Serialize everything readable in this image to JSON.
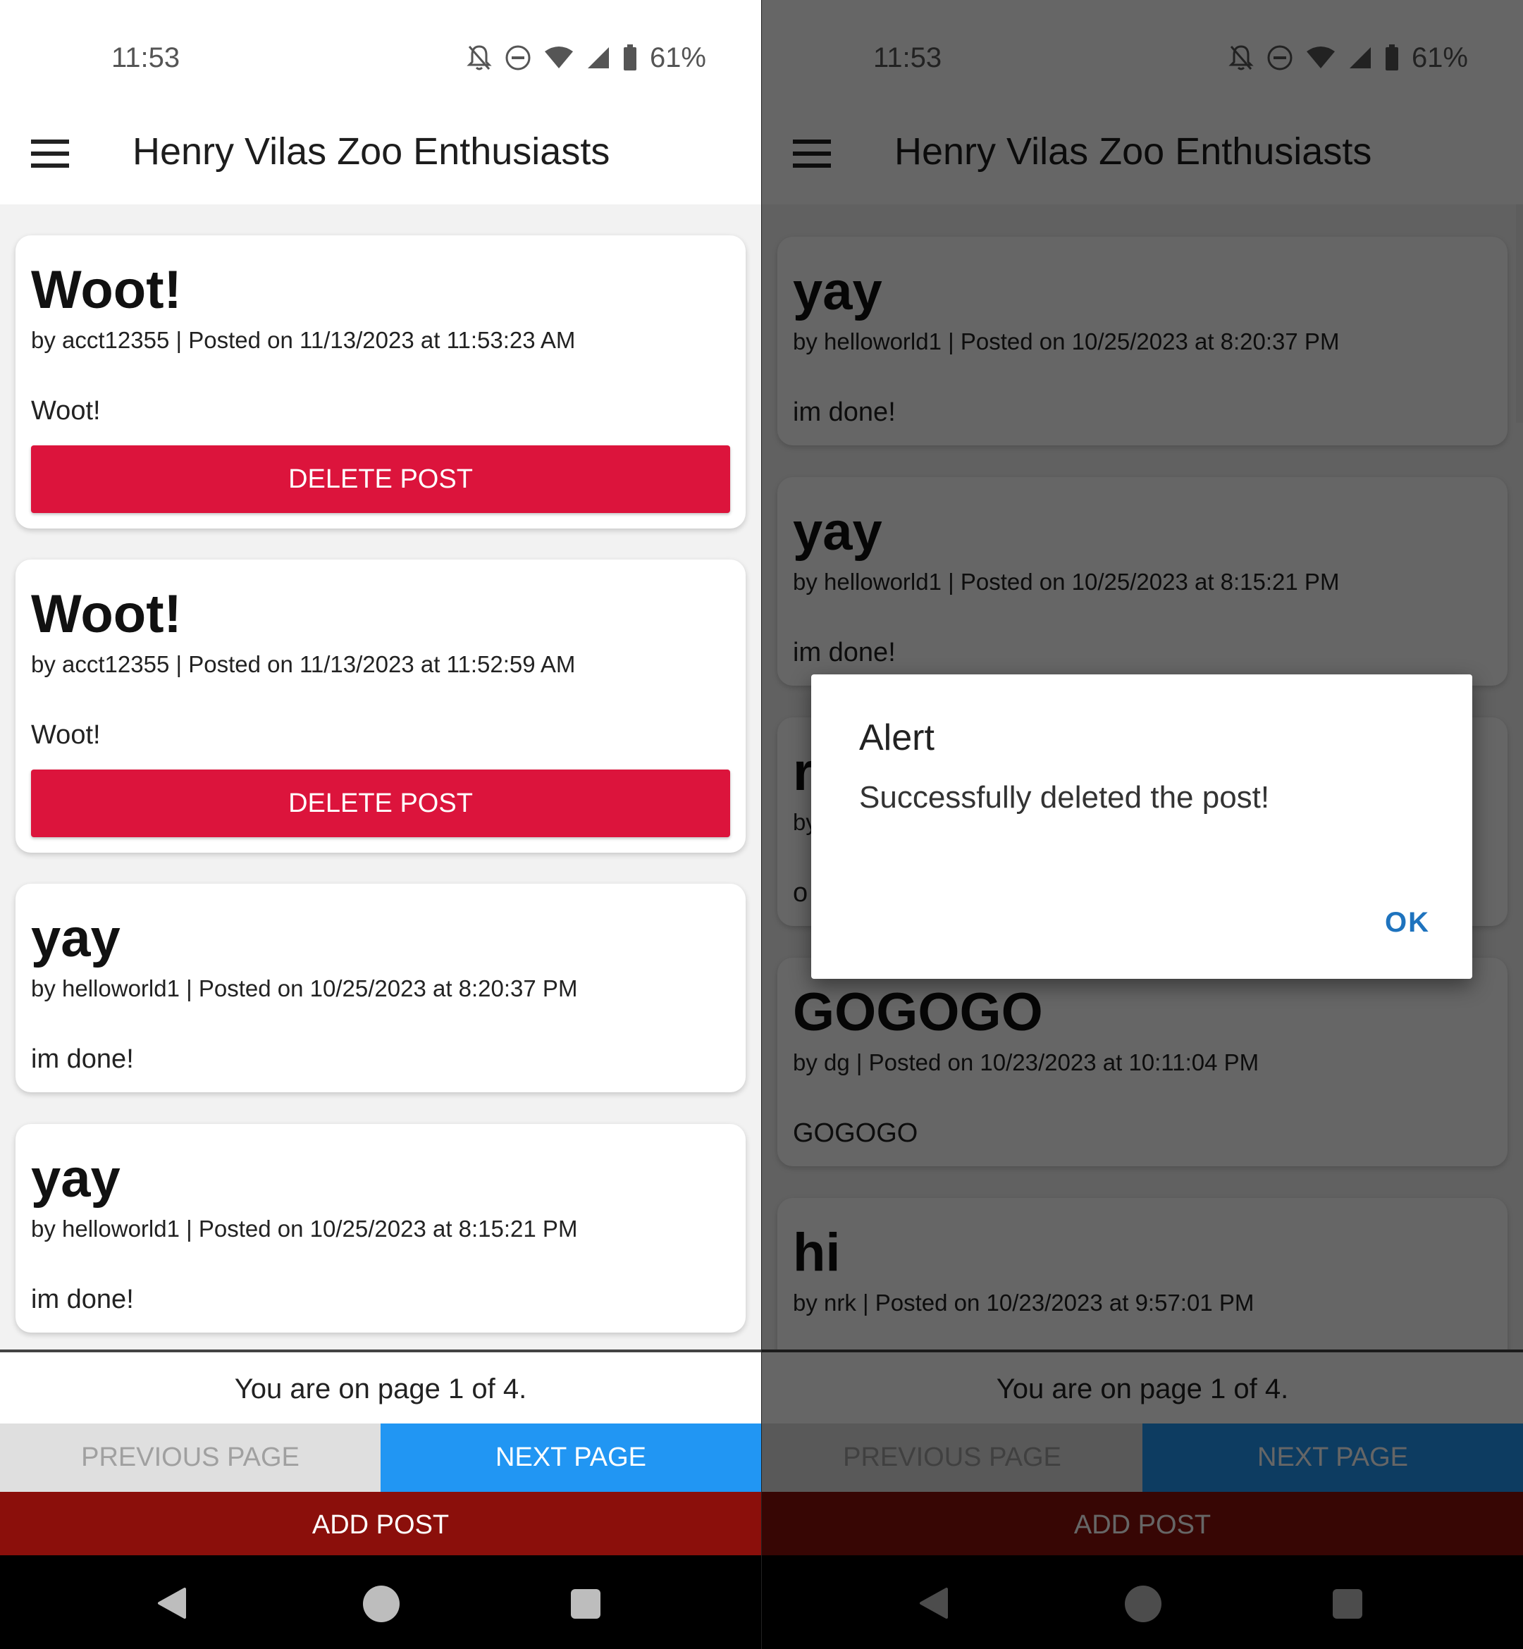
{
  "status_bar": {
    "time": "11:53",
    "battery": "61%"
  },
  "app": {
    "title": "Henry Vilas Zoo Enthusiasts"
  },
  "left_screen": {
    "posts": [
      {
        "title": "Woot!",
        "meta": "by acct12355 | Posted on 11/13/2023 at 11:53:23 AM",
        "body": "Woot!",
        "delete_label": "DELETE POST"
      },
      {
        "title": "Woot!",
        "meta": "by acct12355 | Posted on 11/13/2023 at 11:52:59 AM",
        "body": "Woot!",
        "delete_label": "DELETE POST"
      },
      {
        "title": "yay",
        "meta": "by helloworld1 | Posted on 10/25/2023 at 8:20:37 PM",
        "body": "im done!"
      },
      {
        "title": "yay",
        "meta": "by helloworld1 | Posted on 10/25/2023 at 8:15:21 PM",
        "body": "im done!"
      }
    ]
  },
  "right_screen": {
    "posts": [
      {
        "title": "yay",
        "meta": "by helloworld1 | Posted on 10/25/2023 at 8:20:37 PM",
        "body": "im done!"
      },
      {
        "title": "yay",
        "meta": "by helloworld1 | Posted on 10/25/2023 at 8:15:21 PM",
        "body": "im done!"
      },
      {
        "title": "r",
        "meta": "by",
        "body": "o"
      },
      {
        "title": "GOGOGO",
        "meta": "by dg | Posted on 10/23/2023 at 10:11:04 PM",
        "body": "GOGOGO"
      },
      {
        "title": "hi",
        "meta": "by nrk | Posted on 10/23/2023 at 9:57:01 PM"
      }
    ],
    "dialog": {
      "title": "Alert",
      "message": "Successfully deleted the post!",
      "ok_label": "OK"
    }
  },
  "footer": {
    "page_info": "You are on page 1 of 4.",
    "prev_label": "PREVIOUS PAGE",
    "next_label": "NEXT PAGE",
    "add_label": "ADD POST"
  },
  "colors": {
    "delete": "#dc143c",
    "next": "#2196f3",
    "add": "#8b0f0b",
    "dialog_button": "#1e73be"
  }
}
